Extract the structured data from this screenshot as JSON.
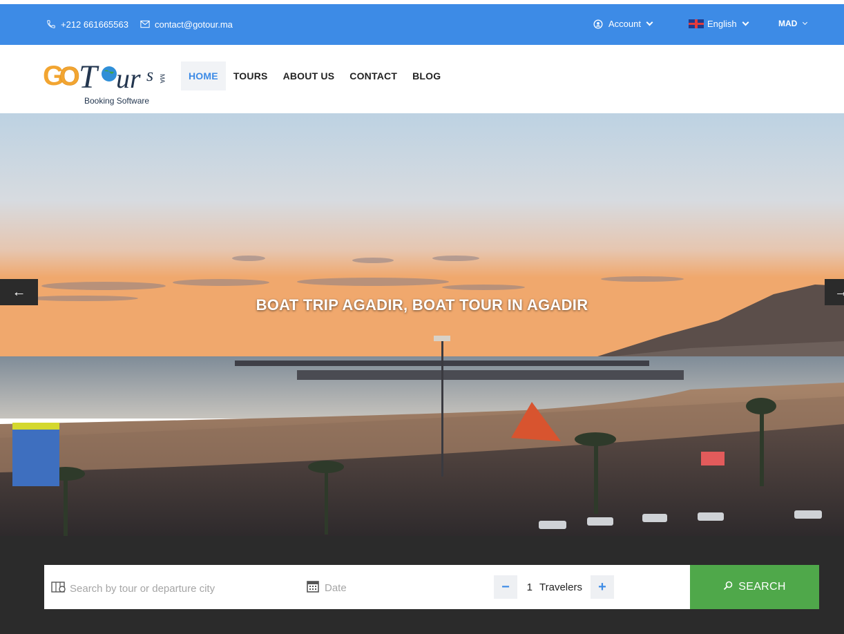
{
  "topbar": {
    "phone": "+212 661665563",
    "email": "contact@gotour.ma",
    "account_label": "Account",
    "language_label": "English",
    "currency_label": "MAD"
  },
  "logo": {
    "brand": "GoTour",
    "suffix": "MA",
    "tagline": "Booking Software"
  },
  "nav": {
    "items": [
      {
        "label": "HOME",
        "active": true
      },
      {
        "label": "TOURS"
      },
      {
        "label": "ABOUT US"
      },
      {
        "label": "CONTACT"
      },
      {
        "label": "BLOG"
      }
    ]
  },
  "hero": {
    "title": "BOAT TRIP AGADIR, BOAT TOUR IN AGADIR",
    "prev_icon": "arrow-left-icon",
    "next_icon": "arrow-right-icon"
  },
  "search": {
    "placeholder": "Search by tour or departure city",
    "date_placeholder": "Date",
    "travelers_count": "1",
    "travelers_label": "Travelers",
    "button_label": "SEARCH"
  },
  "colors": {
    "topbar": "#3d8be6",
    "accent": "#3d8be6",
    "band": "#2b2b2b",
    "search_button": "#4fa84a"
  }
}
